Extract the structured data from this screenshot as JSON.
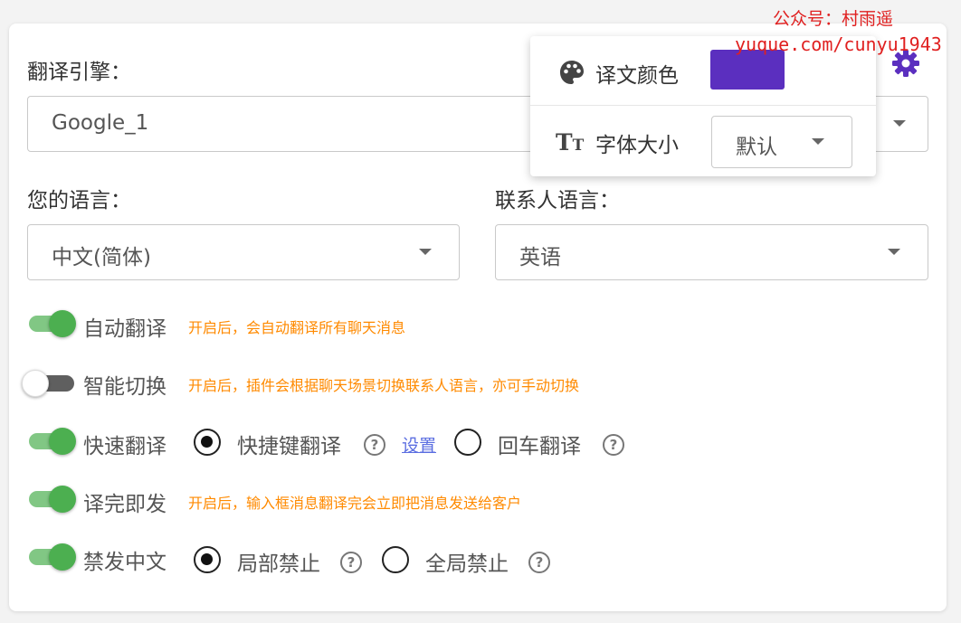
{
  "watermark": {
    "line1": "公众号：村雨遥",
    "line2": "yuque.com/cunyu1943"
  },
  "engine": {
    "label": "翻译引擎：",
    "value": "Google_1"
  },
  "my_language": {
    "label": "您的语言：",
    "value": "中文(简体)"
  },
  "contact_language": {
    "label": "联系人语言：",
    "value": "英语"
  },
  "popover": {
    "color_label": "译文颜色",
    "color_value": "#5b2fbf",
    "font_size_label": "字体大小",
    "font_size_value": "默认"
  },
  "settings": {
    "auto_translate": {
      "label": "自动翻译",
      "hint": "开启后，会自动翻译所有聊天消息",
      "on": true
    },
    "smart_switch": {
      "label": "智能切换",
      "hint": "开启后，插件会根据聊天场景切换联系人语言，亦可手动切换",
      "on": false
    },
    "quick_translate": {
      "label": "快速翻译",
      "on": true,
      "option_shortcut": "快捷键翻译",
      "shortcut_checked": true,
      "link": "设置",
      "option_enter": "回车翻译",
      "enter_checked": false
    },
    "send_after_translate": {
      "label": "译完即发",
      "hint": "开启后，输入框消息翻译完会立即把消息发送给客户",
      "on": true
    },
    "ban_chinese": {
      "label": "禁发中文",
      "on": true,
      "option_partial": "局部禁止",
      "partial_checked": true,
      "option_global": "全局禁止",
      "global_checked": false
    }
  },
  "help_glyph": "?",
  "colors": {
    "toggle_on": "#4caf50",
    "hint": "#ff8a00",
    "gear": "#5b2fbf",
    "watermark": "#e02020"
  }
}
